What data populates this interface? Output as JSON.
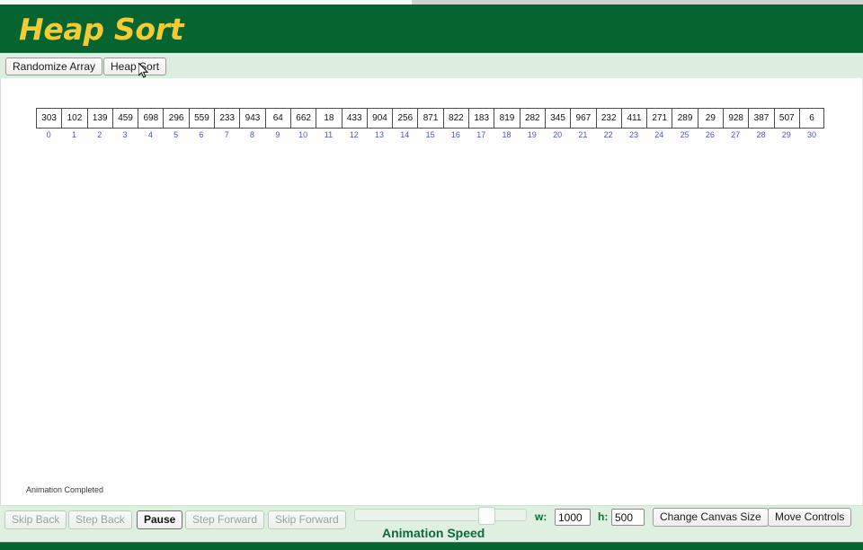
{
  "header": {
    "title": "Heap Sort"
  },
  "toolbar": {
    "randomize_label": "Randomize Array",
    "sort_label": "Heap Sort"
  },
  "canvas": {
    "status": "Animation Completed",
    "array": {
      "values": [
        303,
        102,
        139,
        459,
        698,
        296,
        559,
        233,
        943,
        64,
        662,
        18,
        433,
        904,
        256,
        871,
        822,
        183,
        819,
        282,
        345,
        967,
        232,
        411,
        271,
        289,
        29,
        928,
        387,
        507,
        6
      ],
      "indices": [
        0,
        1,
        2,
        3,
        4,
        5,
        6,
        7,
        8,
        9,
        10,
        11,
        12,
        13,
        14,
        15,
        16,
        17,
        18,
        19,
        20,
        21,
        22,
        23,
        24,
        25,
        26,
        27,
        28,
        29,
        30
      ]
    }
  },
  "controls": {
    "skip_back": "Skip Back",
    "step_back": "Step Back",
    "pause": "Pause",
    "step_forward": "Step Forward",
    "skip_forward": "Skip Forward",
    "animation_speed_label": "Animation Speed",
    "width_label": "w:",
    "width_value": "1000",
    "height_label": "h:",
    "height_value": "500",
    "change_canvas_size": "Change Canvas Size",
    "move_controls": "Move Controls"
  },
  "colors": {
    "header_green": "#05642f",
    "title_gold": "#f2cb35",
    "toolbar_green": "#ddeede",
    "controls_green": "#dff0e0",
    "index_blue": "#4a51d8",
    "label_green": "#0c6b38"
  }
}
